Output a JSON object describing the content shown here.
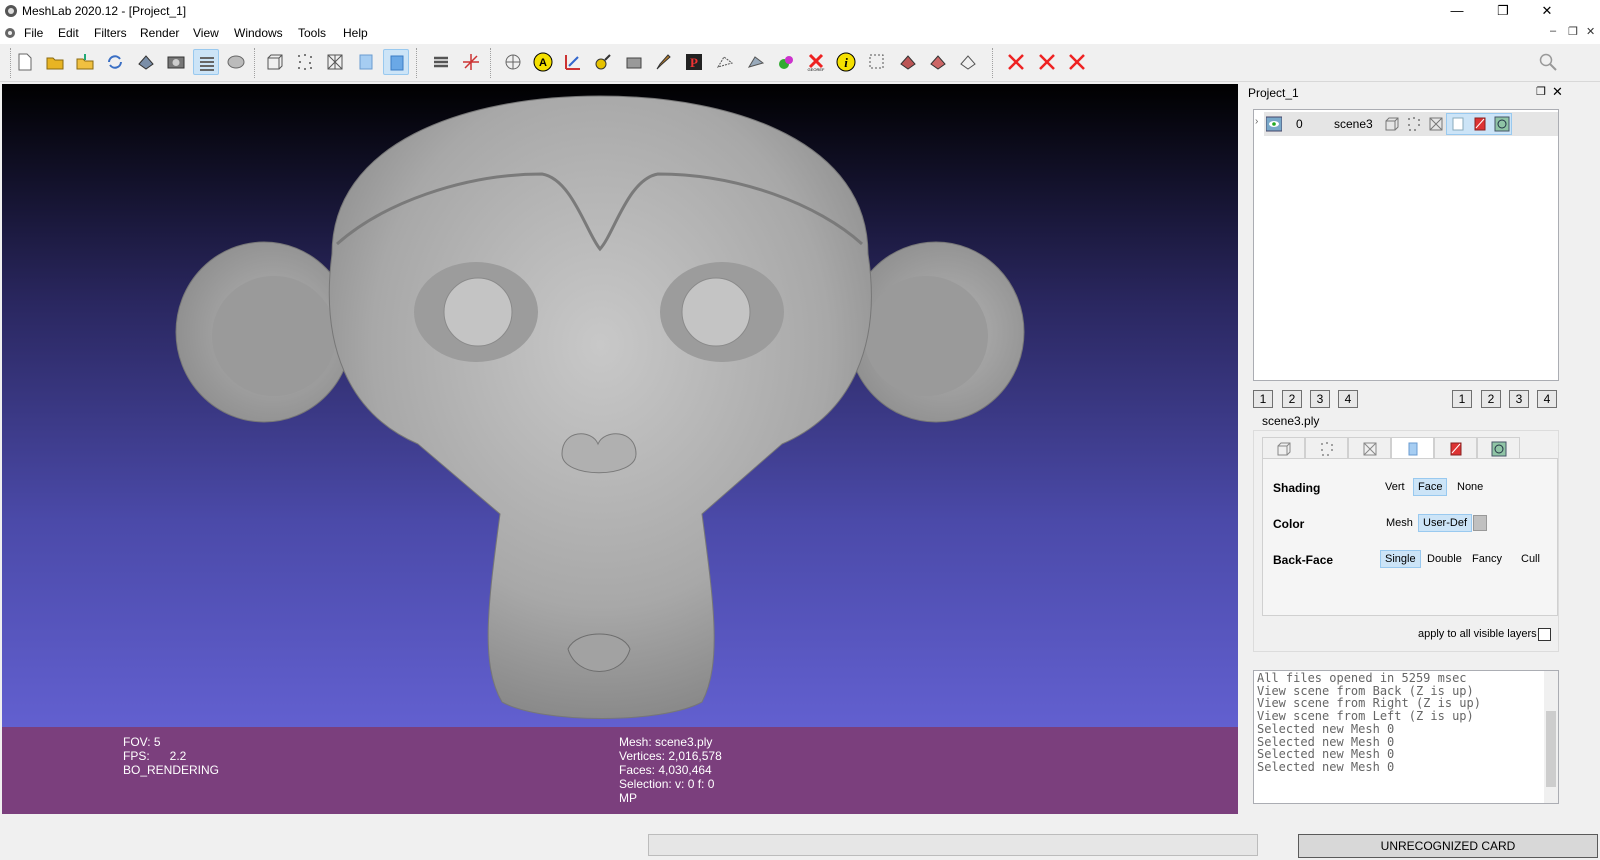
{
  "window": {
    "title": "MeshLab 2020.12 - [Project_1]",
    "minimize": "—",
    "maximize": "❐",
    "close": "✕"
  },
  "menu": [
    "File",
    "Edit",
    "Filters",
    "Render",
    "View",
    "Windows",
    "Tools",
    "Help"
  ],
  "mdi": {
    "minimize": "–",
    "restore": "❐",
    "close": "✕"
  },
  "toolbar": {
    "icons": [
      "new-project-icon",
      "open-project-icon",
      "import-mesh-icon",
      "reload-icon",
      "export-mesh-icon",
      "snapshot-icon",
      "show-layer-dialog-icon",
      "toggle-layer-icon",
      "bounding-box-icon",
      "points-icon",
      "wireframe-icon",
      "flat-icon",
      "smooth-icon",
      "light-icon",
      "axes-icon",
      "trackball-icon",
      "annotation-icon",
      "measure-icon",
      "pick-points-icon",
      "align-icon",
      "paint-icon",
      "parametrization-icon",
      "select-vertices-icon",
      "select-faces-icon",
      "color-paint-icon",
      "georef-icon",
      "info-icon",
      "select-rect-icon",
      "select-connected-icon",
      "delete-vertices-icon",
      "delete-faces-icon",
      "mark-icon",
      "remove-selection-icon",
      "remove-faces-icon",
      "remove-all-icon",
      "search-icon"
    ]
  },
  "viewport": {
    "info_left": [
      "FOV: 5",
      "FPS:      2.2",
      "BO_RENDERING"
    ],
    "info_center": [
      "Mesh: scene3.ply",
      "Vertices: 2,016,578",
      "Faces: 4,030,464",
      "Selection: v: 0 f: 0",
      "MP"
    ]
  },
  "panel": {
    "title": "Project_1",
    "layer": {
      "index": "0",
      "name": "scene3"
    },
    "left_nums": [
      "1",
      "2",
      "3",
      "4"
    ],
    "right_nums": [
      "1",
      "2",
      "3",
      "4"
    ],
    "mesh_file": "scene3.ply",
    "shading": {
      "label": "Shading",
      "options": [
        "Vert",
        "Face",
        "None"
      ],
      "selected": "Face"
    },
    "color": {
      "label": "Color",
      "options": [
        "Mesh",
        "User-Def"
      ],
      "selected": "User-Def"
    },
    "backface": {
      "label": "Back-Face",
      "options": [
        "Single",
        "Double",
        "Fancy",
        "Cull"
      ],
      "selected": "Single"
    },
    "apply_all": "apply to all visible layers"
  },
  "log": [
    "All files opened in 5259 msec",
    "View scene from Back (Z is up)",
    "View scene from Right (Z is up)",
    "View scene from Left (Z is up)",
    "Selected new Mesh 0",
    "Selected new Mesh 0",
    "Selected new Mesh 0",
    "Selected new Mesh 0"
  ],
  "status": {
    "card": "UNRECOGNIZED CARD"
  }
}
